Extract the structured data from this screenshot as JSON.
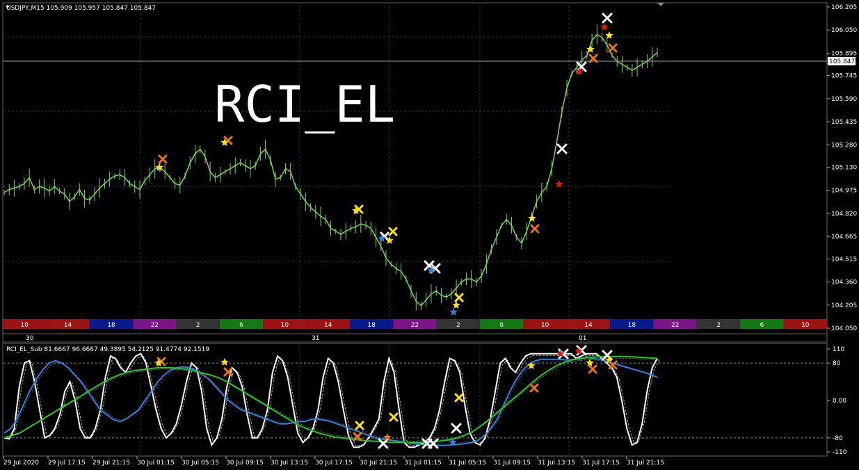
{
  "main_header": "USDJPY,M15  105.909 105.957 105.847 105.847",
  "sub_header": "RCI_EL_Sub 81.6667 96.6667 49.3895 54.2125 91.4774 92.1519",
  "watermark": "RCI_EL",
  "current_price_label": "105.847",
  "colors": {
    "candle": "#7cd65a",
    "price_line": "#9aa0a6",
    "white_line": "#ffffff",
    "blue_line": "#3a7fd6",
    "green_line": "#2ec22e"
  },
  "price_axis_labels": [
    "106.205",
    "106.050",
    "105.895",
    "105.745",
    "105.590",
    "105.435",
    "105.280",
    "105.130",
    "104.975",
    "104.820",
    "104.665",
    "104.515",
    "104.360",
    "104.205",
    "104.050"
  ],
  "sub_axis_labels": [
    "110",
    "80",
    "0.00",
    "-80",
    "-110"
  ],
  "day_labels": [
    "30",
    "31",
    "01"
  ],
  "hour_band": [
    {
      "label": "10",
      "color": "#9b1313"
    },
    {
      "label": "14",
      "color": "#9b1313"
    },
    {
      "label": "18",
      "color": "#0a1a8a"
    },
    {
      "label": "22",
      "color": "#7d1487"
    },
    {
      "label": "2",
      "color": "#333333"
    },
    {
      "label": "6",
      "color": "#137a13"
    },
    {
      "label": "10",
      "color": "#9b1313"
    },
    {
      "label": "14",
      "color": "#9b1313"
    },
    {
      "label": "18",
      "color": "#0a1a8a"
    },
    {
      "label": "22",
      "color": "#7d1487"
    },
    {
      "label": "2",
      "color": "#333333"
    },
    {
      "label": "6",
      "color": "#137a13"
    },
    {
      "label": "10",
      "color": "#9b1313"
    },
    {
      "label": "14",
      "color": "#9b1313"
    },
    {
      "label": "18",
      "color": "#0a1a8a"
    },
    {
      "label": "22",
      "color": "#7d1487"
    },
    {
      "label": "2",
      "color": "#333333"
    },
    {
      "label": "6",
      "color": "#137a13"
    },
    {
      "label": "10",
      "color": "#9b1313"
    }
  ],
  "time_labels": [
    "29 Jul 2020",
    "29 Jul 17:15",
    "29 Jul 21:15",
    "30 Jul 01:15",
    "30 Jul 05:15",
    "30 Jul 09:15",
    "30 Jul 13:15",
    "30 Jul 17:15",
    "30 Jul 21:15",
    "31 Jul 01:15",
    "31 Jul 05:15",
    "31 Jul 09:15",
    "31 Jul 13:15",
    "31 Jul 17:15",
    "31 Jul 21:15"
  ],
  "chart_data": {
    "type": "line",
    "price_ylim": [
      104.05,
      106.205
    ],
    "price_path": [
      104.96,
      104.98,
      104.99,
      105.0,
      105.02,
      105.06,
      104.98,
      105.0,
      104.99,
      104.97,
      105.0,
      104.97,
      104.95,
      104.9,
      104.93,
      104.98,
      104.92,
      104.91,
      104.95,
      104.99,
      105.02,
      105.05,
      105.07,
      105.08,
      105.06,
      105.02,
      105.0,
      104.98,
      105.04,
      105.08,
      105.12,
      105.13,
      105.1,
      105.06,
      105.02,
      105.01,
      105.07,
      105.16,
      105.22,
      105.25,
      105.2,
      105.1,
      105.06,
      105.08,
      105.1,
      105.12,
      105.14,
      105.16,
      105.14,
      105.12,
      105.14,
      105.22,
      105.25,
      105.18,
      105.05,
      105.06,
      105.12,
      105.1,
      105.0,
      104.95,
      104.9,
      104.86,
      104.83,
      104.8,
      104.78,
      104.72,
      104.7,
      104.68,
      104.7,
      104.72,
      104.73,
      104.75,
      104.74,
      104.72,
      104.66,
      104.6,
      104.52,
      104.48,
      104.45,
      104.43,
      104.38,
      104.3,
      104.23,
      104.2,
      104.24,
      104.28,
      104.3,
      104.27,
      104.26,
      104.28,
      104.32,
      104.36,
      104.38,
      104.38,
      104.36,
      104.4,
      104.48,
      104.58,
      104.66,
      104.74,
      104.78,
      104.74,
      104.66,
      104.62,
      104.7,
      104.8,
      104.9,
      104.96,
      105.0,
      105.12,
      105.3,
      105.5,
      105.66,
      105.76,
      105.8,
      105.85,
      105.88,
      105.98,
      106.02,
      106.0,
      105.95,
      105.88,
      105.84,
      105.82,
      105.8,
      105.78,
      105.8,
      105.82,
      105.84,
      105.87,
      105.9
    ],
    "rci_ylim": [
      -110,
      110
    ],
    "series": [
      {
        "values": [
          -80,
          -82,
          -60,
          30,
          80,
          85,
          40,
          -20,
          -80,
          -75,
          -60,
          -30,
          20,
          40,
          0,
          -60,
          -80,
          -80,
          -60,
          -20,
          50,
          95,
          90,
          70,
          60,
          80,
          95,
          100,
          80,
          30,
          -20,
          -60,
          -80,
          -70,
          -50,
          -10,
          40,
          80,
          70,
          20,
          -60,
          -95,
          -80,
          -40,
          30,
          70,
          60,
          30,
          -30,
          -80,
          -80,
          -60,
          -20,
          60,
          95,
          85,
          50,
          -10,
          -70,
          -90,
          -80,
          -60,
          -20,
          50,
          90,
          80,
          40,
          -20,
          -75,
          -100,
          -100,
          -95,
          -80,
          -60,
          -40,
          40,
          90,
          60,
          -20,
          -90,
          -100,
          -100,
          -95,
          -90,
          -80,
          -60,
          -20,
          40,
          90,
          85,
          60,
          -10,
          -70,
          -90,
          -95,
          -80,
          -40,
          20,
          80,
          90,
          70,
          60,
          80,
          95,
          100,
          100,
          100,
          100,
          100,
          100,
          100,
          100,
          100,
          90,
          95,
          100,
          100,
          100,
          90,
          80,
          70,
          50,
          0,
          -60,
          -95,
          -90,
          -50,
          20,
          70,
          90
        ]
      },
      {
        "values": [
          -70,
          -60,
          -40,
          -10,
          20,
          45,
          65,
          80,
          85,
          80,
          70,
          55,
          40,
          20,
          0,
          -20,
          -30,
          -40,
          -45,
          -40,
          -30,
          -20,
          0,
          20,
          40,
          55,
          65,
          70,
          72,
          70,
          65,
          55,
          45,
          30,
          15,
          0,
          -10,
          -20,
          -25,
          -30,
          -35,
          -40,
          -45,
          -50,
          -50,
          -48,
          -45,
          -45,
          -40,
          -40,
          -42,
          -45,
          -50,
          -55,
          -60,
          -65,
          -70,
          -75,
          -80,
          -82,
          -84,
          -86,
          -88,
          -90,
          -92,
          -94,
          -95,
          -95,
          -96,
          -96,
          -95,
          -94,
          -92,
          -90,
          -85,
          -75,
          -60,
          -40,
          -10,
          20,
          45,
          65,
          78,
          85,
          88,
          88,
          88,
          88,
          86,
          88,
          90,
          92,
          90,
          88,
          84,
          80,
          76,
          72,
          68,
          64,
          60,
          55,
          50
        ]
      },
      {
        "values": [
          -80,
          -75,
          -70,
          -60,
          -50,
          -40,
          -30,
          -20,
          -10,
          0,
          10,
          20,
          30,
          40,
          48,
          55,
          60,
          64,
          66,
          68,
          70,
          70,
          70,
          68,
          66,
          62,
          58,
          54,
          48,
          40,
          30,
          20,
          10,
          0,
          -10,
          -20,
          -30,
          -40,
          -50,
          -58,
          -64,
          -70,
          -74,
          -78,
          -80,
          -82,
          -84,
          -86,
          -87,
          -88,
          -89,
          -90,
          -90,
          -90,
          -90,
          -89,
          -88,
          -86,
          -84,
          -80,
          -74,
          -66,
          -55,
          -42,
          -28,
          -14,
          0,
          14,
          28,
          42,
          55,
          66,
          75,
          82,
          87,
          90,
          92,
          93,
          94,
          94,
          94,
          94,
          93,
          92,
          91,
          90
        ]
      }
    ]
  }
}
